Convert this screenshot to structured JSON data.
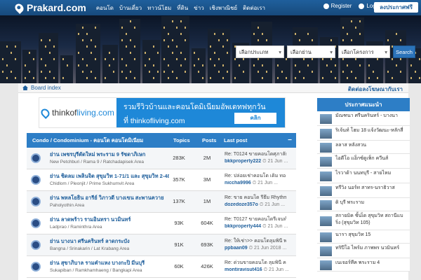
{
  "header": {
    "brand": "Prakard.com",
    "nav": [
      "คอนโด",
      "บ้านเดี่ยว",
      "ทาวน์โฮม",
      "ที่ดิน",
      "ข่าว",
      "เชิงพาณิชย์",
      "ติดต่อเรา"
    ],
    "register": "Register",
    "login": "Login",
    "post_free": "ลงประกาศฟรี"
  },
  "search": {
    "type": "เลือกประเภท",
    "area": "เลือกย่าน",
    "project": "เลือกโครงการ",
    "button": "Search"
  },
  "breadcrumb": {
    "home": "Board index",
    "contact": "ติดต่อลงโฆษณากับเรา"
  },
  "banner": {
    "brand_prefix": "thinkof",
    "brand_suffix": "living.com",
    "line1": "รวมรีวิวบ้านและคอนโดมิเนียมอัพเดทฟทุกวัน",
    "line2": "ที่ thinkofliving.com",
    "cta": "คลิก"
  },
  "forum": {
    "title": "Condo / Condominium - คอนโด คอนโดมิเนียม",
    "col_topics": "Topics",
    "col_posts": "Posts",
    "col_last": "Last post",
    "rows": [
      {
        "name": "ย่าน เพชรบุรีตัดใหม่ พระราม 9 รัชดาภิเษก",
        "sub": "New Petchburi / Rama 9 / Ratchadapisek Area",
        "topics": "283K",
        "posts": "2M",
        "last_title": "Re: T0124 ขายคอนโดศุภาลัย",
        "last_by": "bkkproperty222",
        "last_date": "21 Jun ..."
      },
      {
        "name": "ย่าน ชิดลม เพลินจิต สุขุมวิท 1-71/1 และ สุขุมวิท 2-48",
        "sub": "Chidlom / Pleonjit / Prime Sukhumvit Area",
        "topics": "357K",
        "posts": "3M",
        "last_title": "Re: ปล่อยเช่าคอนโด เดิม ทองหล่อ",
        "last_by": "niccha9996",
        "last_date": "21 Jun ..."
      },
      {
        "name": "ย่าน พหลโยธิน อารีย์ วิภาวดี บางเขน สะพานควาย",
        "sub": "Paholyothin Area",
        "topics": "137K",
        "posts": "1M",
        "last_title": "Re: ขาย คอนโด รีธึม Rhythm",
        "last_by": "dozedoze357o",
        "last_date": "21 Jun ..."
      },
      {
        "name": "ย่าน ลาดพร้าว รามอินทรา นวมินทร์",
        "sub": "Ladprao / Raminthra Area",
        "topics": "93K",
        "posts": "604K",
        "last_title": "Re: T0127 ขายคอนโดรีเจนท์",
        "last_by": "bkkproperty444",
        "last_date": "21 Jun ..."
      },
      {
        "name": "ย่าน บางนา ศรีนครินทร์ ลาดกระบัง",
        "sub": "Bangna / Srinakarin / Lat Krabang Area",
        "topics": "91K",
        "posts": "693K",
        "last_title": "Re: ให้เช่า>> คอนโดลุมพินี พาร์ค",
        "last_by": "ppbaan09",
        "last_date": "21 Jun 2018 ..."
      },
      {
        "name": "ย่าน สุขาภิบาล รามคำแหง บางกะปิ มีนบุรี",
        "sub": "Sukapiban / Ramkhamhaeng / Bangkapi Area",
        "topics": "60K",
        "posts": "426K",
        "last_title": "Re: ด่วนขายคอนโด ลุมพินี คลองตัน",
        "last_by": "montiravisut416",
        "last_date": "21 Jun ..."
      }
    ]
  },
  "sidebar": {
    "title": "ประกาศแนะนำ",
    "items": [
      "มัณฑนา ศรีนครินทร์ - บางนา",
      "ริเจ้นท์ โฮม 18 แจ้งวัฒนะ-หลักสี่",
      "ลลาส หลังสวน",
      "ไอดีโอ แอ็กซ์ดูเพ็ก ควีนส์",
      "ไรวาด้า นนทบุรี - สายไหม",
      "ทรีวิง นอร์ท สาทร-นราธิวาส",
      "ดิ บุรี พระราม",
      "สกายมิค ชั้นเ็ด สุขุมวิท สถานีแบริ่ง (สุขุมวิท 105)",
      "นารา สุขุมวิท 15",
      "ทริปีโอ ไพร์ม ภาพพร นวมินทร์",
      "เนเจอร์ทีค พระราม 4"
    ]
  }
}
